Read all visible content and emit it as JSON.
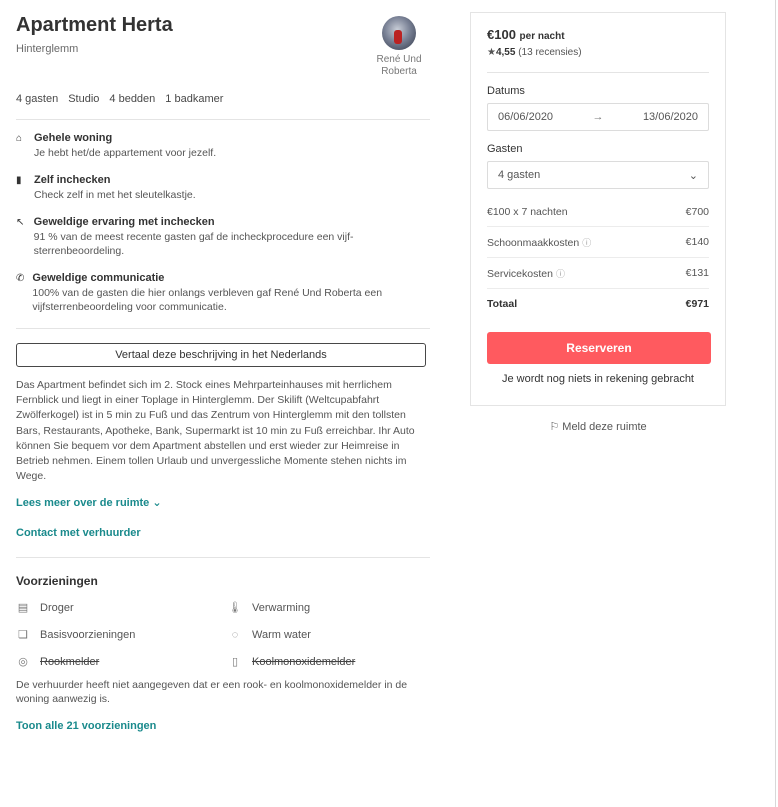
{
  "listing": {
    "title": "Apartment Herta",
    "location": "Hinterglemm",
    "host_name": "René Und Roberta",
    "specs": [
      "4 gasten",
      "Studio",
      "4 bedden",
      "1 badkamer"
    ]
  },
  "highlights": [
    {
      "icon": "home-icon",
      "glyph": "⌂",
      "title": "Gehele woning",
      "text": "Je hebt het/de appartement voor jezelf."
    },
    {
      "icon": "key-icon",
      "glyph": "▮",
      "title": "Zelf inchecken",
      "text": "Check zelf in met het sleutelkastje."
    },
    {
      "icon": "tag-icon",
      "glyph": "↖",
      "title": "Geweldige ervaring met inchecken",
      "text": "91 % van de meest recente gasten gaf de incheckprocedure een vijf-sterrenbeoordeling."
    },
    {
      "icon": "phone-icon",
      "glyph": "✆",
      "title": "Geweldige communicatie",
      "text": "100% van de gasten die hier onlangs verbleven gaf René Und Roberta een vijfsterrenbeoordeling voor communicatie."
    }
  ],
  "translate_label": "Vertaal deze beschrijving in het Nederlands",
  "description": "Das Apartment befindet sich im 2. Stock eines Mehrparteinhauses mit herrlichem Fernblick und liegt in einer Toplage in Hinterglemm. Der Skilift (Weltcupabfahrt Zwölferkogel) ist in 5 min zu Fuß und das Zentrum von Hinterglemm mit den tollsten Bars, Restaurants, Apotheke, Bank, Supermarkt ist 10 min zu Fuß erreichbar. Ihr Auto können Sie bequem vor dem Apartment abstellen und erst wieder zur Heimreise in Betrieb nehmen. Einem tollen Urlaub und unvergessliche Momente stehen nichts im Wege.",
  "read_more": "Lees meer over de ruimte ⌄",
  "contact": "Contact met verhuurder",
  "amenities": {
    "title": "Voorzieningen",
    "items": [
      {
        "icon": "dryer-icon",
        "glyph": "▤",
        "label": "Droger",
        "available": true
      },
      {
        "icon": "thermometer-icon",
        "glyph": "🌡",
        "label": "Verwarming",
        "available": true
      },
      {
        "icon": "basics-icon",
        "glyph": "❏",
        "label": "Basisvoorzieningen",
        "available": true
      },
      {
        "icon": "water-icon",
        "glyph": "◌",
        "label": "Warm water",
        "available": true
      },
      {
        "icon": "smoke-detector-icon",
        "glyph": "◎",
        "label": "Rookmelder",
        "available": false
      },
      {
        "icon": "co-detector-icon",
        "glyph": "▯",
        "label": "Koolmonoxidemelder",
        "available": false
      }
    ],
    "note": "De verhuurder heeft niet aangegeven dat er een rook- en koolmonoxidemelder in de woning aanwezig is.",
    "show_all": "Toon alle 21 voorzieningen"
  },
  "booking": {
    "price": "€100",
    "per_night": "per nacht",
    "rating": "4,55",
    "reviews": "(13 recensies)",
    "dates_label": "Datums",
    "checkin": "06/06/2020",
    "checkout": "13/06/2020",
    "guests_label": "Gasten",
    "guests_value": "4 gasten",
    "rows": [
      {
        "label": "€100 x 7 nachten",
        "value": "€700",
        "info": false
      },
      {
        "label": "Schoonmaakkosten",
        "value": "€140",
        "info": true
      },
      {
        "label": "Servicekosten",
        "value": "€131",
        "info": true
      }
    ],
    "total_label": "Totaal",
    "total_value": "€971",
    "reserve_label": "Reserveren",
    "no_charge": "Je wordt nog niets in rekening gebracht"
  },
  "report_label": "Meld deze ruimte"
}
